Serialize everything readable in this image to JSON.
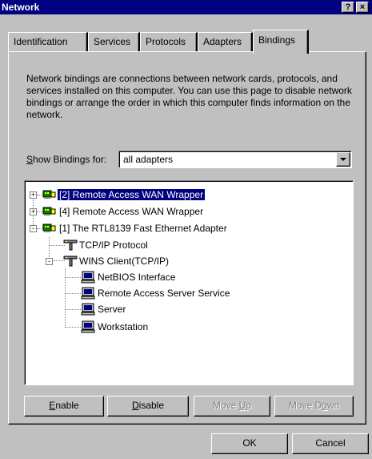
{
  "window": {
    "title": "Network",
    "help_glyph": "?",
    "close_glyph": "×"
  },
  "tabs": [
    {
      "label": "Identification"
    },
    {
      "label": "Services"
    },
    {
      "label": "Protocols"
    },
    {
      "label": "Adapters"
    },
    {
      "label": "Bindings",
      "active": true
    }
  ],
  "description": "Network bindings are connections between network cards, protocols, and services installed on this computer.  You can use this page to disable network bindings or arrange the order in which this computer finds information on the network.",
  "show_bindings": {
    "label_mnemonic": "S",
    "label_rest": "how Bindings for:",
    "selected": "all adapters"
  },
  "tree": [
    {
      "label": "[2] Remote Access WAN Wrapper",
      "icon": "network-adapter-icon",
      "expander": "+",
      "selected": true
    },
    {
      "label": "[4] Remote Access WAN Wrapper",
      "icon": "network-adapter-icon",
      "expander": "+"
    },
    {
      "label": "[1] The RTL8139 Fast Ethernet Adapter",
      "icon": "network-adapter-icon",
      "expander": "-"
    },
    {
      "label": "TCP/IP Protocol",
      "icon": "protocol-icon"
    },
    {
      "label": "WINS Client(TCP/IP)",
      "icon": "protocol-icon",
      "expander": "-"
    },
    {
      "label": "NetBIOS Interface",
      "icon": "service-computer-icon"
    },
    {
      "label": "Remote Access Server Service",
      "icon": "service-computer-icon"
    },
    {
      "label": "Server",
      "icon": "service-computer-icon"
    },
    {
      "label": "Workstation",
      "icon": "service-computer-icon"
    }
  ],
  "buttons": {
    "enable": {
      "mnemonic": "E",
      "rest": "nable"
    },
    "disable": {
      "mnemonic": "D",
      "rest": "isable"
    },
    "move_up": {
      "pre": "Move ",
      "mnemonic": "U",
      "rest": "p"
    },
    "move_down": {
      "pre": "Move D",
      "mnemonic": "o",
      "rest": "wn"
    },
    "ok": "OK",
    "cancel": "Cancel"
  }
}
